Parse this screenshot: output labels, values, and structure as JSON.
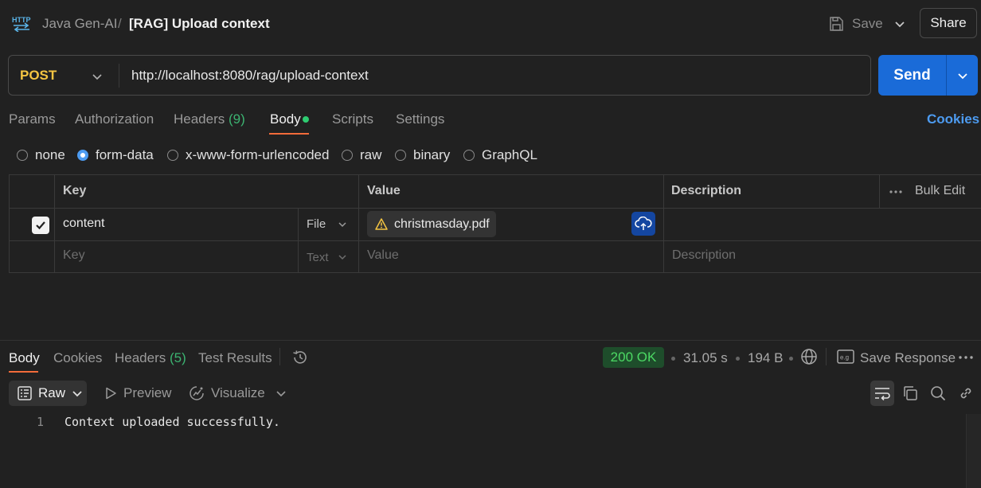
{
  "header": {
    "icon": "http-icon",
    "workspace": "Java Gen-AI",
    "separator": "/",
    "title": "[RAG] Upload context",
    "save_label": "Save",
    "share_label": "Share"
  },
  "request": {
    "method": "POST",
    "url": "http://localhost:8080/rag/upload-context",
    "send_label": "Send"
  },
  "request_tabs": {
    "params": "Params",
    "authorization": "Authorization",
    "headers": "Headers",
    "headers_count": "(9)",
    "body": "Body",
    "scripts": "Scripts",
    "settings": "Settings",
    "cookies": "Cookies",
    "active": "Body"
  },
  "body_types": {
    "none": "none",
    "form_data": "form-data",
    "urlencoded": "x-www-form-urlencoded",
    "raw": "raw",
    "binary": "binary",
    "graphql": "GraphQL",
    "selected": "form-data"
  },
  "form_table": {
    "headers": {
      "key": "Key",
      "value": "Value",
      "description": "Description",
      "bulk_edit": "Bulk Edit"
    },
    "rows": [
      {
        "checked": true,
        "key": "content",
        "type": "File",
        "value": "christmasday.pdf",
        "description": ""
      }
    ],
    "empty_row": {
      "key_placeholder": "Key",
      "type": "Text",
      "value_placeholder": "Value",
      "description_placeholder": "Description"
    }
  },
  "response_tabs": {
    "body": "Body",
    "cookies": "Cookies",
    "headers": "Headers",
    "headers_count": "(5)",
    "test_results": "Test Results",
    "active": "Body"
  },
  "response_meta": {
    "status": "200 OK",
    "time": "31.05 s",
    "size": "194 B",
    "save_response": "Save Response"
  },
  "response_toolbar": {
    "format": "Raw",
    "preview": "Preview",
    "visualize": "Visualize"
  },
  "response_body": {
    "lines": [
      {
        "no": "1",
        "text": "Context uploaded successfully."
      }
    ]
  },
  "colors": {
    "background": "#212121",
    "method": "#f5c542",
    "send": "#1a6bd8",
    "accent_tab": "#f26b3a",
    "link": "#4d9bf0",
    "status_ok": "#4cd964"
  }
}
